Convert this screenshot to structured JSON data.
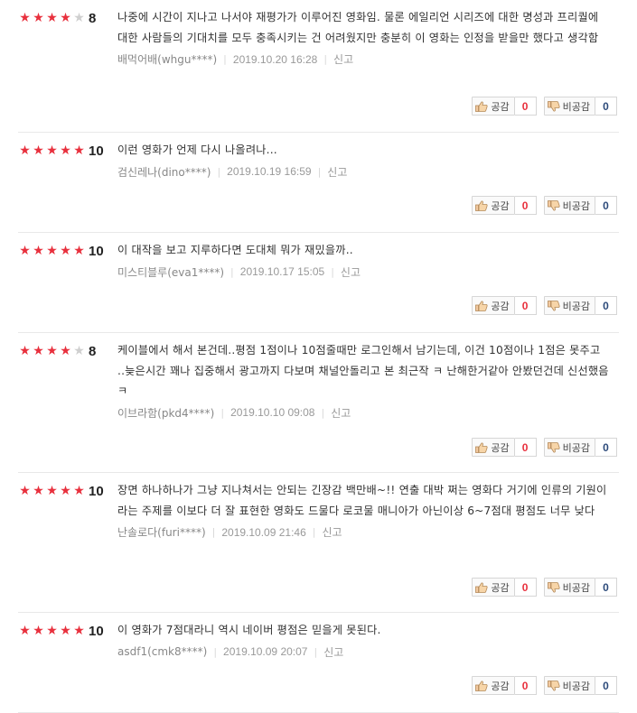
{
  "ui": {
    "up_label": "공감",
    "down_label": "비공감",
    "report_label": "신고",
    "star_on": "★",
    "star_off": "★"
  },
  "colors": {
    "star_on": "#e8303d",
    "star_off": "#cfcfcf",
    "up_count": "#e8303d",
    "down_count": "#2c4a7a"
  },
  "reviews": [
    {
      "stars": 4,
      "score": "8",
      "text": "나중에 시간이 지나고 나서야 재평가가 이루어진 영화임. 물론 에일리언 시리즈에 대한 명성과 프리퀄에 대한 사람들의 기대치를 모두 충족시키는 건 어려웠지만 충분히 이 영화는 인정을 받을만 했다고 생각함",
      "user": "배먹어배(whgu****)",
      "date": "2019.10.20 16:28",
      "up": "0",
      "down": "0"
    },
    {
      "stars": 5,
      "score": "10",
      "text": "이런 영화가 언제 다시 나올려나...",
      "user": "검신레나(dino****)",
      "date": "2019.10.19 16:59",
      "up": "0",
      "down": "0"
    },
    {
      "stars": 5,
      "score": "10",
      "text": "이 대작을 보고 지루하다면 도대체 뭐가 재밌을까..",
      "user": "미스티블루(eva1****)",
      "date": "2019.10.17 15:05",
      "up": "0",
      "down": "0"
    },
    {
      "stars": 4,
      "score": "8",
      "text": "케이블에서 해서 본건데..평점 1점이나 10점줄때만 로그인해서 남기는데, 이건 10점이나 1점은 못주고 ..늦은시간 꽤나 집중해서 광고까지 다보며 채널안돌리고 본 최근작 ㅋ 난해한거같아 안봤던건데 신선했음 ㅋ",
      "user": "이브라함(pkd4****)",
      "date": "2019.10.10 09:08",
      "up": "0",
      "down": "0"
    },
    {
      "stars": 5,
      "score": "10",
      "text": "장면 하나하나가 그냥 지나쳐서는 안되는 긴장감 백만배~!! 연출 대박 쩌는 영화다 거기에 인류의 기원이라는 주제를 이보다 더 잘 표현한 영화도 드물다 로코물 매니아가 아닌이상 6~7점대 평점도 너무 낮다",
      "user": "난솔로다(furi****)",
      "date": "2019.10.09 21:46",
      "up": "0",
      "down": "0"
    },
    {
      "stars": 5,
      "score": "10",
      "text": "이 영화가 7점대라니 역시 네이버 평점은 믿을게 못된다.",
      "user": "asdf1(cmk8****)",
      "date": "2019.10.09 20:07",
      "up": "0",
      "down": "0"
    }
  ]
}
